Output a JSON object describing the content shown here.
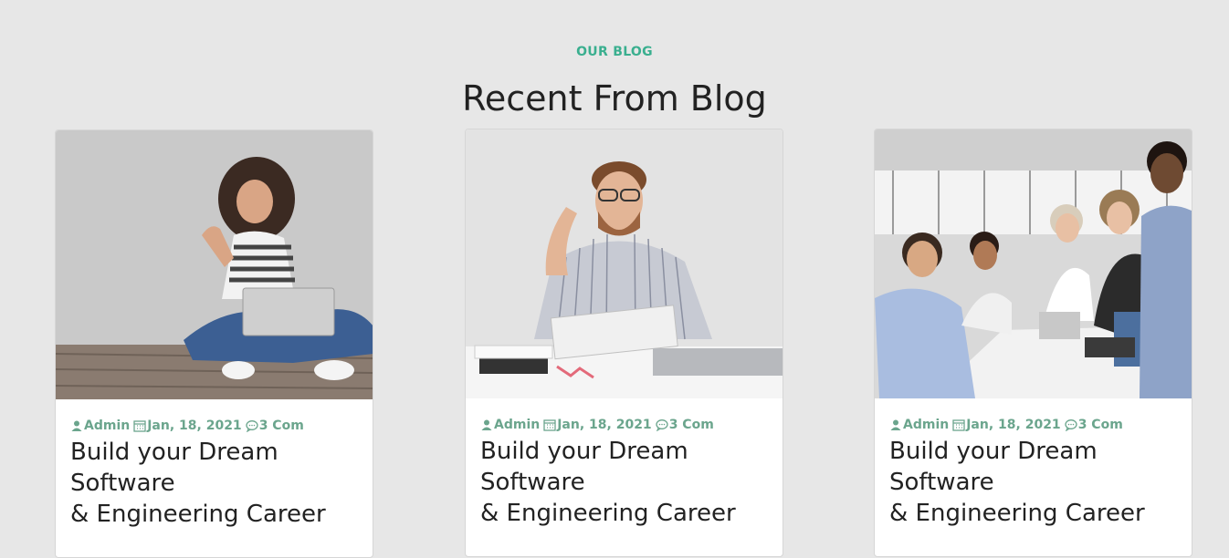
{
  "section": {
    "eyebrow": "OUR BLOG",
    "title": "Recent From Blog"
  },
  "posts": [
    {
      "author": "Admin",
      "date": "Jan, 18, 2021",
      "comments": "3 Com",
      "title_line1": "Build your Dream",
      "title_line2": "Software",
      "title_line3": "& Engineering Career",
      "image": "woman-with-laptop-photo"
    },
    {
      "author": "Admin",
      "date": "Jan, 18, 2021",
      "comments": "3 Com",
      "title_line1": "Build your Dream",
      "title_line2": "Software",
      "title_line3": "& Engineering Career",
      "image": "man-at-desk-photo"
    },
    {
      "author": "Admin",
      "date": "Jan, 18, 2021",
      "comments": "3 Com",
      "title_line1": "Build your Dream",
      "title_line2": "Software",
      "title_line3": "& Engineering Career",
      "image": "team-thumbs-up-photo"
    }
  ],
  "colors": {
    "accent": "#3aaf8f",
    "meta": "#6ba58d",
    "background": "#e7e7e7"
  }
}
